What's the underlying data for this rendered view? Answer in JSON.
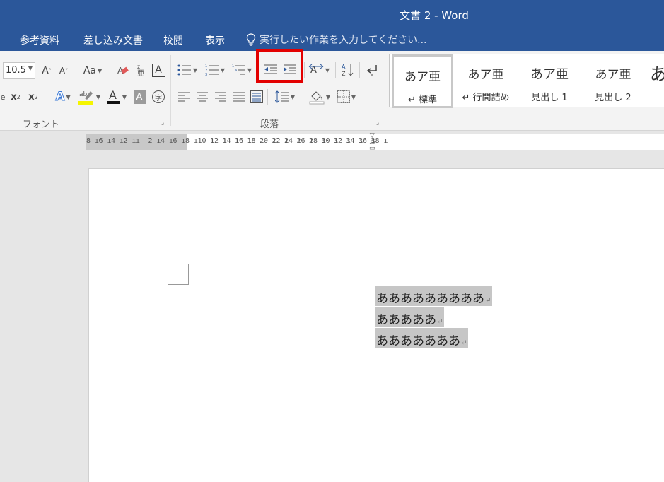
{
  "app": {
    "title": "文書 2 - Word"
  },
  "menu": {
    "tabs": [
      "参考資料",
      "差し込み文書",
      "校閲",
      "表示"
    ],
    "tell_me": "実行したい作業を入力してください..."
  },
  "ribbon": {
    "font_size": "10.5",
    "font_group_label": "フォント",
    "paragraph_group_label": "段落",
    "styles": [
      {
        "sample": "あア亜",
        "name": "↵ 標準"
      },
      {
        "sample": "あア亜",
        "name": "↵ 行間詰め"
      },
      {
        "sample": "あア亜",
        "name": "見出し 1"
      },
      {
        "sample": "あア亜",
        "name": "見出し 2"
      },
      {
        "sample": "あ",
        "name": ""
      }
    ],
    "highlight_color": "#e30000"
  },
  "ruler": {
    "labels": [
      "8",
      "6",
      "4",
      "2",
      "",
      "2",
      "4",
      "6",
      "8",
      "10",
      "12",
      "14",
      "16",
      "18",
      "20",
      "22",
      "24",
      "26",
      "28",
      "30",
      "32",
      "34",
      "36",
      "38"
    ]
  },
  "document": {
    "lines": [
      "あああああああああ",
      "あああああ",
      "あああああああ"
    ],
    "paragraph_mark": "↵"
  }
}
